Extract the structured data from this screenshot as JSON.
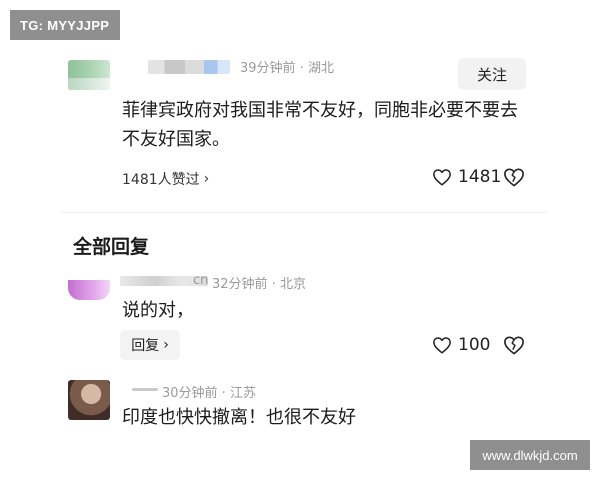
{
  "watermarks": {
    "top_left": "TG: MYYJJPP",
    "bottom_right": "www.dlwkjd.com"
  },
  "main_comment": {
    "meta": "39分钟前 · 湖北",
    "follow_label": "关注",
    "text": "菲律宾政府对我国非常不友好，同胞非必要不要去不友好国家。",
    "likes_summary": "1481人赞过",
    "like_count": "1481",
    "chevron": "›"
  },
  "section": {
    "title": "全部回复"
  },
  "replies": [
    {
      "username_partial": "cn",
      "meta": "32分钟前 · 北京",
      "text": "说的对，",
      "reply_label": "回复",
      "reply_chevron": "›",
      "like_count": "100"
    },
    {
      "meta": "30分钟前 · 江苏",
      "text": "印度也快快撤离！也很不友好"
    }
  ],
  "icons": {
    "like": "heart-outline-icon",
    "dislike": "broken-heart-icon"
  }
}
